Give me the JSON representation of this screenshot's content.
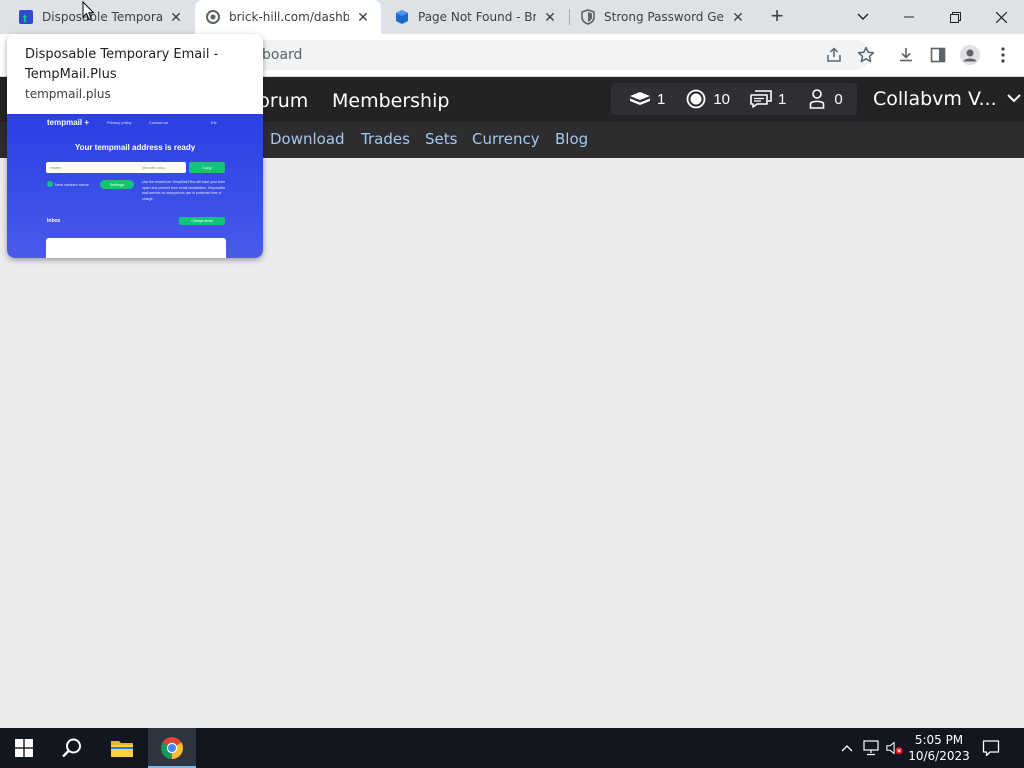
{
  "browser": {
    "tabs": [
      {
        "title": "Disposable Temporary E",
        "favicon": "tempmail-favicon",
        "active": false
      },
      {
        "title": "brick-hill.com/dashboa",
        "favicon": "loading-icon",
        "active": true
      },
      {
        "title": "Page Not Found - Brick",
        "favicon": "brickhill-favicon",
        "active": false
      },
      {
        "title": "Strong Password Gene",
        "favicon": "shield-favicon",
        "active": false
      }
    ],
    "url_fragment": "board",
    "hover_card": {
      "title": "Disposable Temporary Email - TempMail.Plus",
      "domain": "tempmail.plus",
      "preview": {
        "logo": "tempmail +",
        "nav": [
          "Privacy policy",
          "Contact us",
          "EN"
        ],
        "heading": "Your tempmail address is ready",
        "input_value": "rname",
        "domain_value": "@mailto.plus",
        "copy_label": "Copy",
        "checkbox_label": "New random name",
        "settings_label": "Settings",
        "description": "Use the email from TempMail.Plus will save your from spam and prevent from email newsletters. Disposable mail service for anonymous use in protected free of charge.",
        "inbox_label": "Inbox",
        "inbox_button": "Change email"
      }
    }
  },
  "site": {
    "nav_main": [
      "Forum",
      "Membership"
    ],
    "stats": [
      {
        "icon": "bricks-icon",
        "value": "1"
      },
      {
        "icon": "coins-icon",
        "value": "10"
      },
      {
        "icon": "messages-icon",
        "value": "1"
      },
      {
        "icon": "friends-icon",
        "value": "0"
      }
    ],
    "username": "Collabvm V...",
    "nav_sub": [
      "Download",
      "Trades",
      "Sets",
      "Currency",
      "Blog"
    ]
  },
  "taskbar": {
    "time": "5:05 PM",
    "date": "10/6/2023"
  },
  "colors": {
    "site_header": "#232325",
    "site_subnav": "#2d2d30",
    "subnav_link": "#a6c8ee",
    "tempmail_blue": "#2a3fe3",
    "tempmail_green": "#15c27a"
  }
}
